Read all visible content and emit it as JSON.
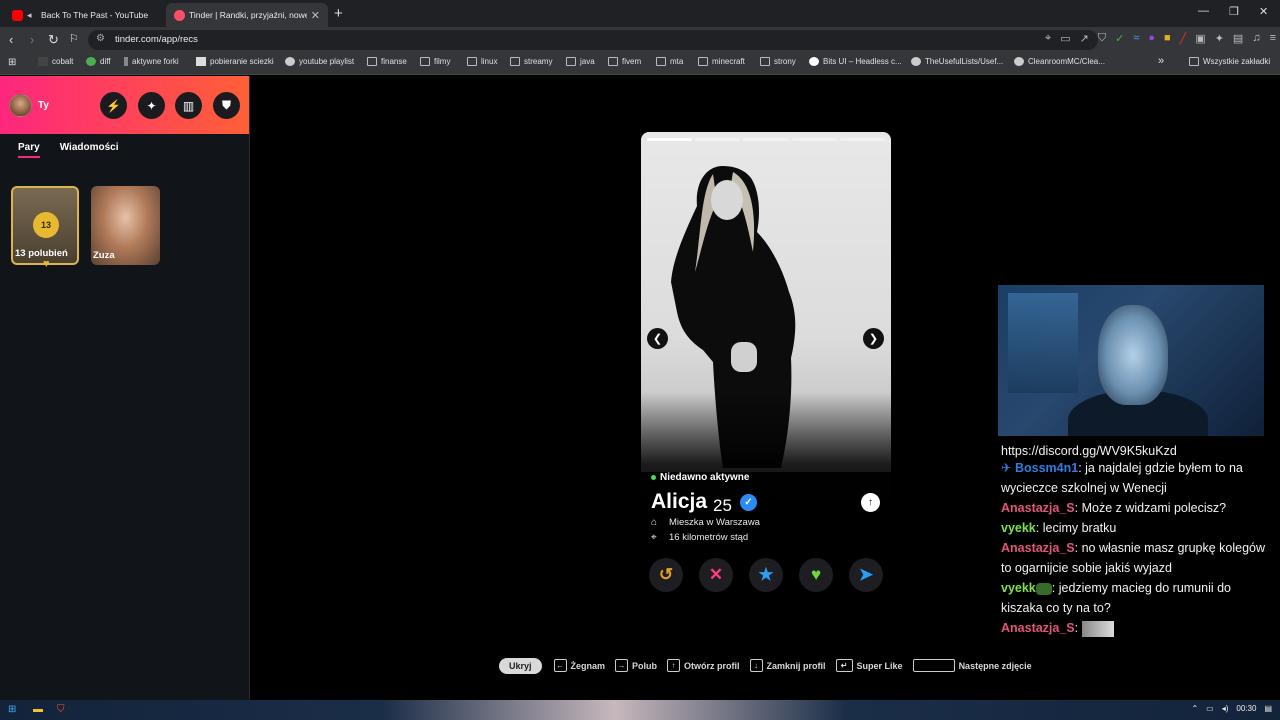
{
  "browser": {
    "tabs": [
      {
        "title": "Back To The Past - YouTube",
        "active": false
      },
      {
        "title": "Tinder | Randki, przyjaźni, nowe z",
        "active": true
      }
    ],
    "new_tab": "+",
    "url": "tinder.com/app/recs",
    "bookmarks": [
      "cobalt",
      "diff",
      "aktywne forki",
      "pobieranie sciezki",
      "youtube playlist",
      "finanse",
      "filmy",
      "linux",
      "streamy",
      "java",
      "fivem",
      "mta",
      "minecraft",
      "strony",
      "Bits UI – Headless c...",
      "TheUsefulLists/Usef...",
      "CleanroomMC/Clea..."
    ],
    "bookmarks_overflow": "»",
    "all_bookmarks": "Wszystkie zakładki"
  },
  "sidebar": {
    "user_label": "Ty",
    "tabs": [
      "Pary",
      "Wiadomości"
    ],
    "likes_count": "13",
    "likes_label": "13 polubień",
    "match_name": "Zuza"
  },
  "profile": {
    "status": "Niedawno aktywne",
    "name": "Alicja",
    "age": "25",
    "lives_in": "Mieszka w Warszawa",
    "distance": "16 kilometrów stąd",
    "photo_count": 5,
    "current_photo": 1
  },
  "shortcuts": {
    "hide": "Ukryj",
    "items": [
      "Żegnam",
      "Polub",
      "Otwórz profil",
      "Zamknij profil",
      "Super Like",
      "Następne zdjęcie"
    ]
  },
  "chat": {
    "partial_top": "https://discord.gg/WV9K5kuKzd",
    "messages": [
      {
        "user": "Bossm4n1",
        "text": ": ja najdalej gdzie byłem to na wycieczce szkolnej w Wenecji",
        "color": "#2f7de1"
      },
      {
        "user": "Anastazja_S",
        "text": ": Może z widzami polecisz?",
        "color": "#e0567a"
      },
      {
        "user": "vyekk",
        "text": ": lecimy bratku",
        "color": "#7fe24a"
      },
      {
        "user": "Anastazja_S",
        "text": ": no własnie masz grupkę kolegów to ogarnijcie sobie jakiś wyjazd",
        "color": "#e0567a"
      },
      {
        "user": "vyekk",
        "text": ": jedziemy macieg do rumunii do kiszaka co ty na to?",
        "color": "#7fe24a"
      },
      {
        "user": "Anastazja_S",
        "text": ":",
        "color": "#e0567a"
      }
    ]
  },
  "taskbar": {
    "time": "00:30"
  },
  "colors": {
    "brand_gradient_start": "#fd267d",
    "brand_gradient_end": "#ff6036",
    "verified": "#2a8df5",
    "online": "#4cd964"
  }
}
